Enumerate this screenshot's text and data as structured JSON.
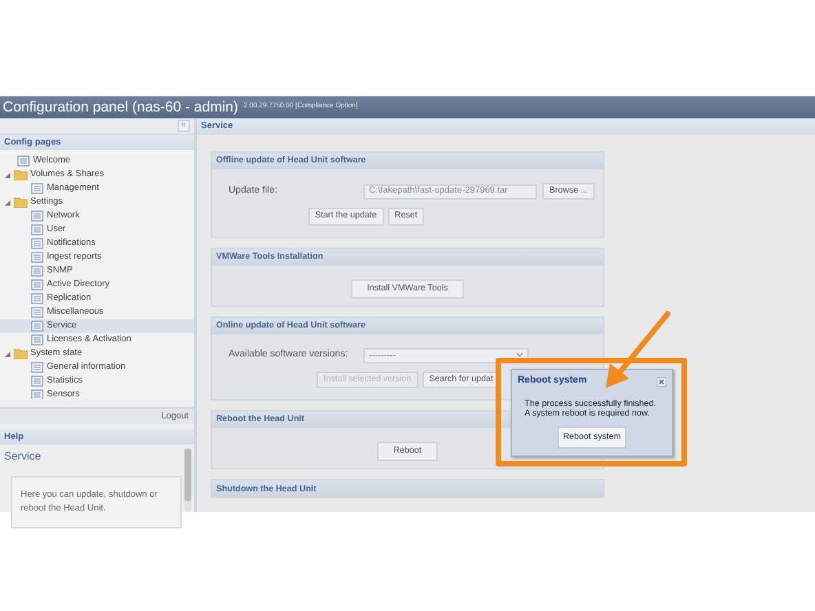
{
  "window": {
    "title": "Configuration panel (nas-60 - admin)",
    "version": "2.00.29.7750.00 [Compliance Option]"
  },
  "sidebar": {
    "collapse_button": "«",
    "section_title": "Config pages",
    "tree": [
      {
        "label": "Welcome",
        "kind": "page",
        "selected": false
      },
      {
        "label": "Volumes & Shares",
        "kind": "folder",
        "expanded": true,
        "selected": false,
        "children": [
          {
            "label": "Management",
            "kind": "page",
            "selected": false
          }
        ]
      },
      {
        "label": "Settings",
        "kind": "folder",
        "expanded": true,
        "selected": false,
        "children": [
          {
            "label": "Network",
            "kind": "page",
            "selected": false
          },
          {
            "label": "User",
            "kind": "page",
            "selected": false
          },
          {
            "label": "Notifications",
            "kind": "page",
            "selected": false
          },
          {
            "label": "Ingest reports",
            "kind": "page",
            "selected": false
          },
          {
            "label": "SNMP",
            "kind": "page",
            "selected": false
          },
          {
            "label": "Active Directory",
            "kind": "page",
            "selected": false
          },
          {
            "label": "Replication",
            "kind": "page",
            "selected": false
          },
          {
            "label": "Miscellaneous",
            "kind": "page",
            "selected": false
          },
          {
            "label": "Service",
            "kind": "page",
            "selected": true
          },
          {
            "label": "Licenses & Activation",
            "kind": "page",
            "selected": false
          }
        ]
      },
      {
        "label": "System state",
        "kind": "folder",
        "expanded": true,
        "selected": false,
        "children": [
          {
            "label": "General information",
            "kind": "page",
            "selected": false
          },
          {
            "label": "Statistics",
            "kind": "page",
            "selected": false
          },
          {
            "label": "Sensors",
            "kind": "page",
            "selected": false
          }
        ]
      }
    ],
    "logout": "Logout"
  },
  "help": {
    "title": "Help",
    "heading": "Service",
    "text": "Here you can update, shutdown or reboot the Head Unit."
  },
  "main": {
    "title": "Service",
    "panels": [
      {
        "title": "Offline update of Head Unit software",
        "field": {
          "kind": "file",
          "label": "Update file:",
          "value": "C:\\fakepath\\fast-update-297969.tar",
          "button": "Browse ..."
        },
        "buttons": [
          {
            "label": "Start the update",
            "disabled": false
          },
          {
            "label": "Reset",
            "disabled": false
          }
        ]
      },
      {
        "title": "VMWare Tools Installation",
        "buttons": [
          {
            "label": "Install VMWare Tools",
            "disabled": false
          }
        ]
      },
      {
        "title": "Online update of Head Unit software",
        "field": {
          "kind": "select",
          "label": "Available software versions:",
          "value": "---------"
        },
        "buttons": [
          {
            "label": "Install selected version",
            "disabled": true
          },
          {
            "label": "Search for updat",
            "disabled": false
          }
        ]
      },
      {
        "title": "Reboot the Head Unit",
        "buttons": [
          {
            "label": "Reboot",
            "disabled": false
          }
        ]
      },
      {
        "title": "Shutdown the Head Unit"
      }
    ]
  },
  "dialog": {
    "title": "Reboot system",
    "lines": [
      "The process successfully finished.",
      "A system reboot is required now."
    ],
    "button": "Reboot system"
  }
}
